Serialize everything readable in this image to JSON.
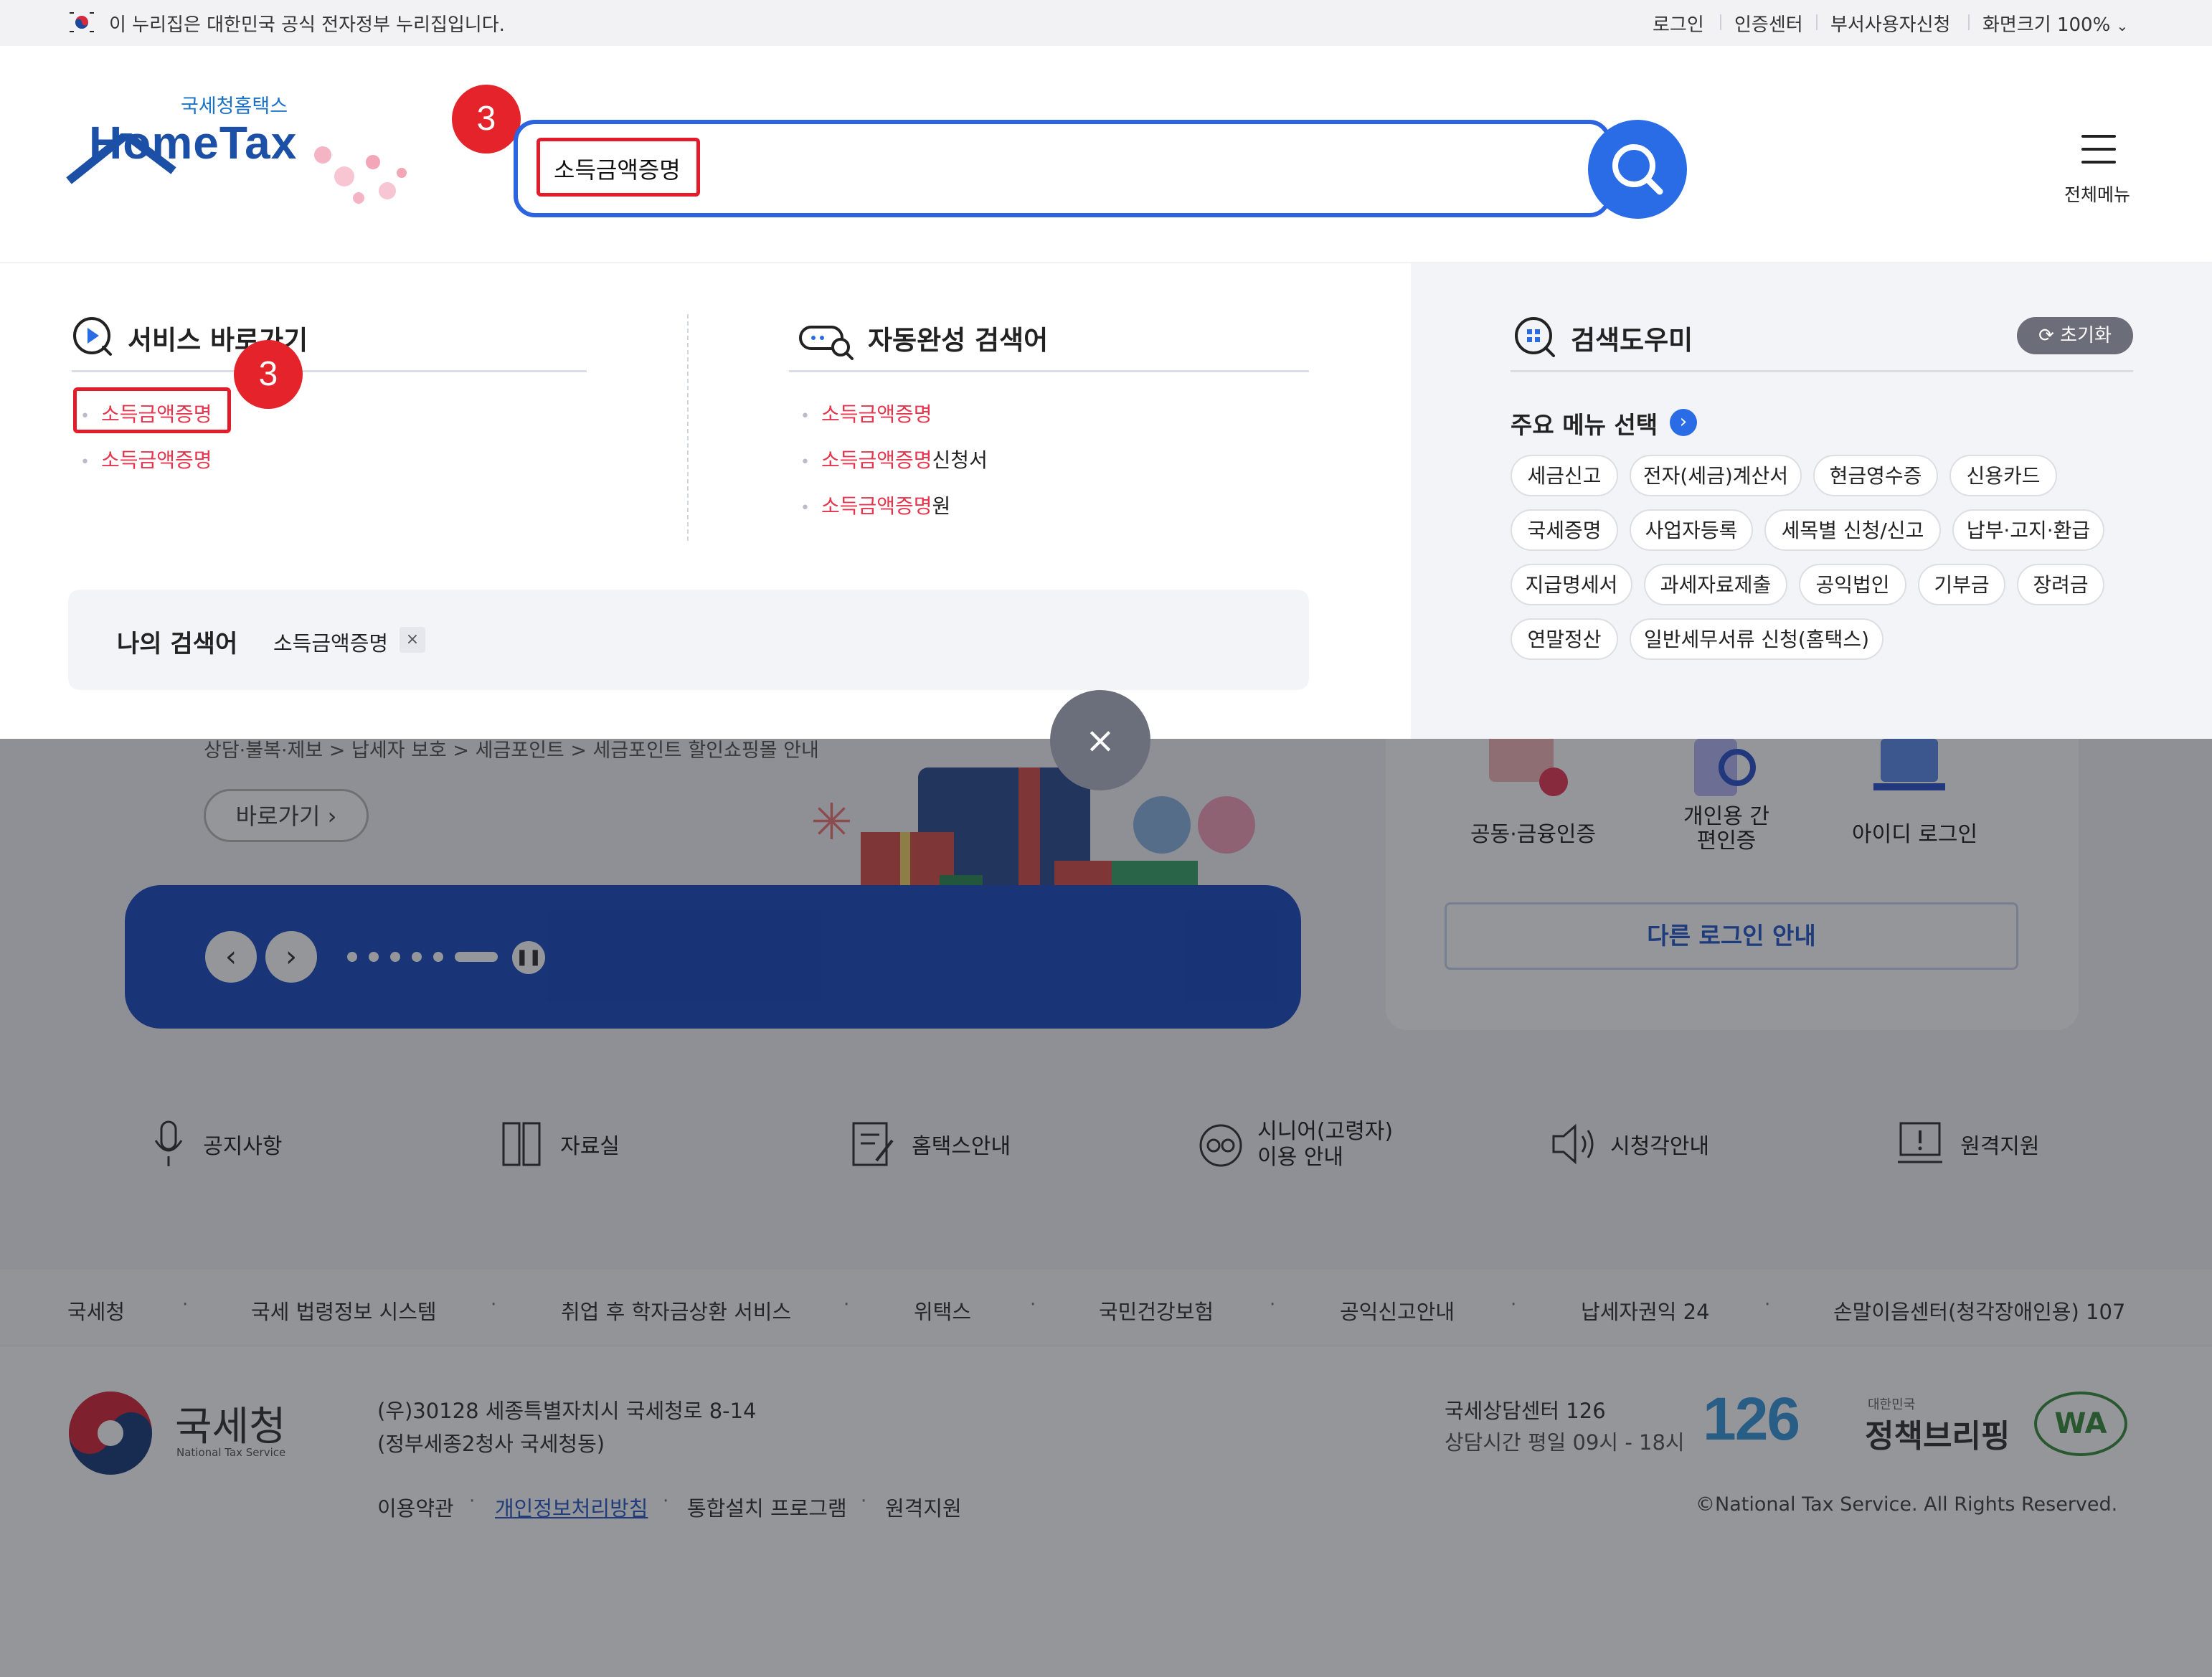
{
  "topbar": {
    "notice": "이 누리집은 대한민국 공식 전자정부 누리집입니다.",
    "links": [
      "로그인",
      "인증센터",
      "부서사용자신청",
      "화면크기 100%"
    ]
  },
  "header": {
    "logo_small": "국세청홈택스",
    "logo_big": "HomeTax",
    "search_value": "소득금액증명",
    "menu_label": "전체메뉴",
    "badge": "3"
  },
  "panel": {
    "service": {
      "title": "서비스 바로가기",
      "items": [
        "소득금액증명",
        "소득금액증명"
      ],
      "badge": "3"
    },
    "autocomplete": {
      "title": "자동완성 검색어",
      "items": [
        {
          "match": "소득금액증명",
          "suffix": ""
        },
        {
          "match": "소득금액증명",
          "suffix": "신청서"
        },
        {
          "match": "소득금액증명",
          "suffix": "원"
        }
      ]
    },
    "my_search": {
      "title": "나의 검색어",
      "term": "소득금액증명",
      "remove": "×"
    },
    "helper": {
      "title": "검색도우미",
      "reset": "초기화",
      "menu_title": "주요 메뉴 선택",
      "chips": [
        "세금신고",
        "전자(세금)계산서",
        "현금영수증",
        "신용카드",
        "국세증명",
        "사업자등록",
        "세목별 신청/신고",
        "납부·고지·환급",
        "지급명세서",
        "과세자료제출",
        "공익법인",
        "기부금",
        "장려금",
        "연말정산",
        "일반세무서류 신청(홈택스)"
      ]
    },
    "close": "×"
  },
  "background": {
    "breadcrumb": "상담·불복·제보 > 납세자 보호 > 세금포인트 > 세금포인트 할인쇼핑몰 안내",
    "goto": "바로가기",
    "login_options": [
      "공동·금융인증",
      "개인용 간편인증",
      "아이디 로그인"
    ],
    "other_login": "다른 로그인 안내",
    "quick_links": [
      "공지사항",
      "자료실",
      "홈택스안내",
      "시니어(고령자) 이용 안내",
      "시청각안내",
      "원격지원"
    ]
  },
  "footer": {
    "links": [
      "국세청",
      "국세 법령정보 시스템",
      "취업 후 학자금상환 서비스",
      "위택스",
      "국민건강보험",
      "공익신고안내",
      "납세자권익 24",
      "손말이음센터(청각장애인용) 107"
    ],
    "org": "국세청",
    "org_en": "National Tax Service",
    "address1": "(우)30128 세종특별자치시 국세청로 8-14",
    "address2": "(정부세종2청사 국세청동)",
    "center": "국세상담센터 126",
    "hours": "상담시간 평일 09시 - 18시",
    "logo_126": "126",
    "briefing_small": "대한민국",
    "briefing": "정책브리핑",
    "wa": "WA",
    "bottom_links": [
      "이용약관",
      "개인정보처리방침",
      "통합설치 프로그램",
      "원격지원"
    ],
    "copyright": "©National Tax Service. All Rights Reserved."
  },
  "colors": {
    "accent": "#2a6be6",
    "highlight": "#e31c2c",
    "match": "#e5344b"
  }
}
